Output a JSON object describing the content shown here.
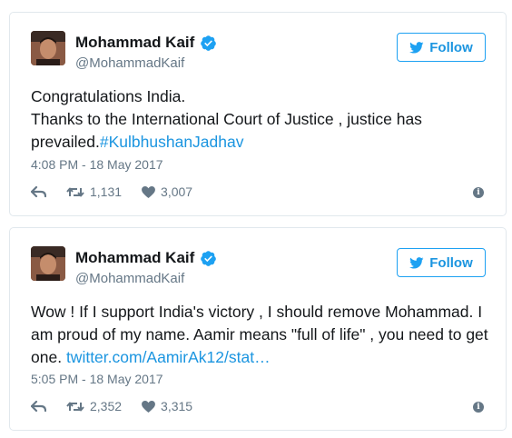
{
  "brand_color": "#1da1f2",
  "tweets": [
    {
      "author_name": "Mohammad Kaif",
      "author_handle": "@MohammadKaif",
      "follow_label": "Follow",
      "text_lines": [
        "Congratulations India.",
        "Thanks to the International Court of Justice , justice has prevailed."
      ],
      "hashtag": "#KulbhushanJadhav",
      "timestamp": "4:08 PM - 18 May 2017",
      "retweets": "1,131",
      "likes": "3,007",
      "icons": [
        "reply-icon",
        "retweet-icon",
        "heart-icon",
        "info-icon"
      ]
    },
    {
      "author_name": "Mohammad Kaif",
      "author_handle": "@MohammadKaif",
      "follow_label": "Follow",
      "text": "Wow ! If I support India's victory , I should remove Mohammad. I am proud of my name. Aamir means \"full of life\" , you need to get one.",
      "link": "twitter.com/AamirAk12/stat…",
      "timestamp": "5:05 PM - 18 May 2017",
      "retweets": "2,352",
      "likes": "3,315",
      "icons": [
        "reply-icon",
        "retweet-icon",
        "heart-icon",
        "info-icon"
      ]
    }
  ]
}
